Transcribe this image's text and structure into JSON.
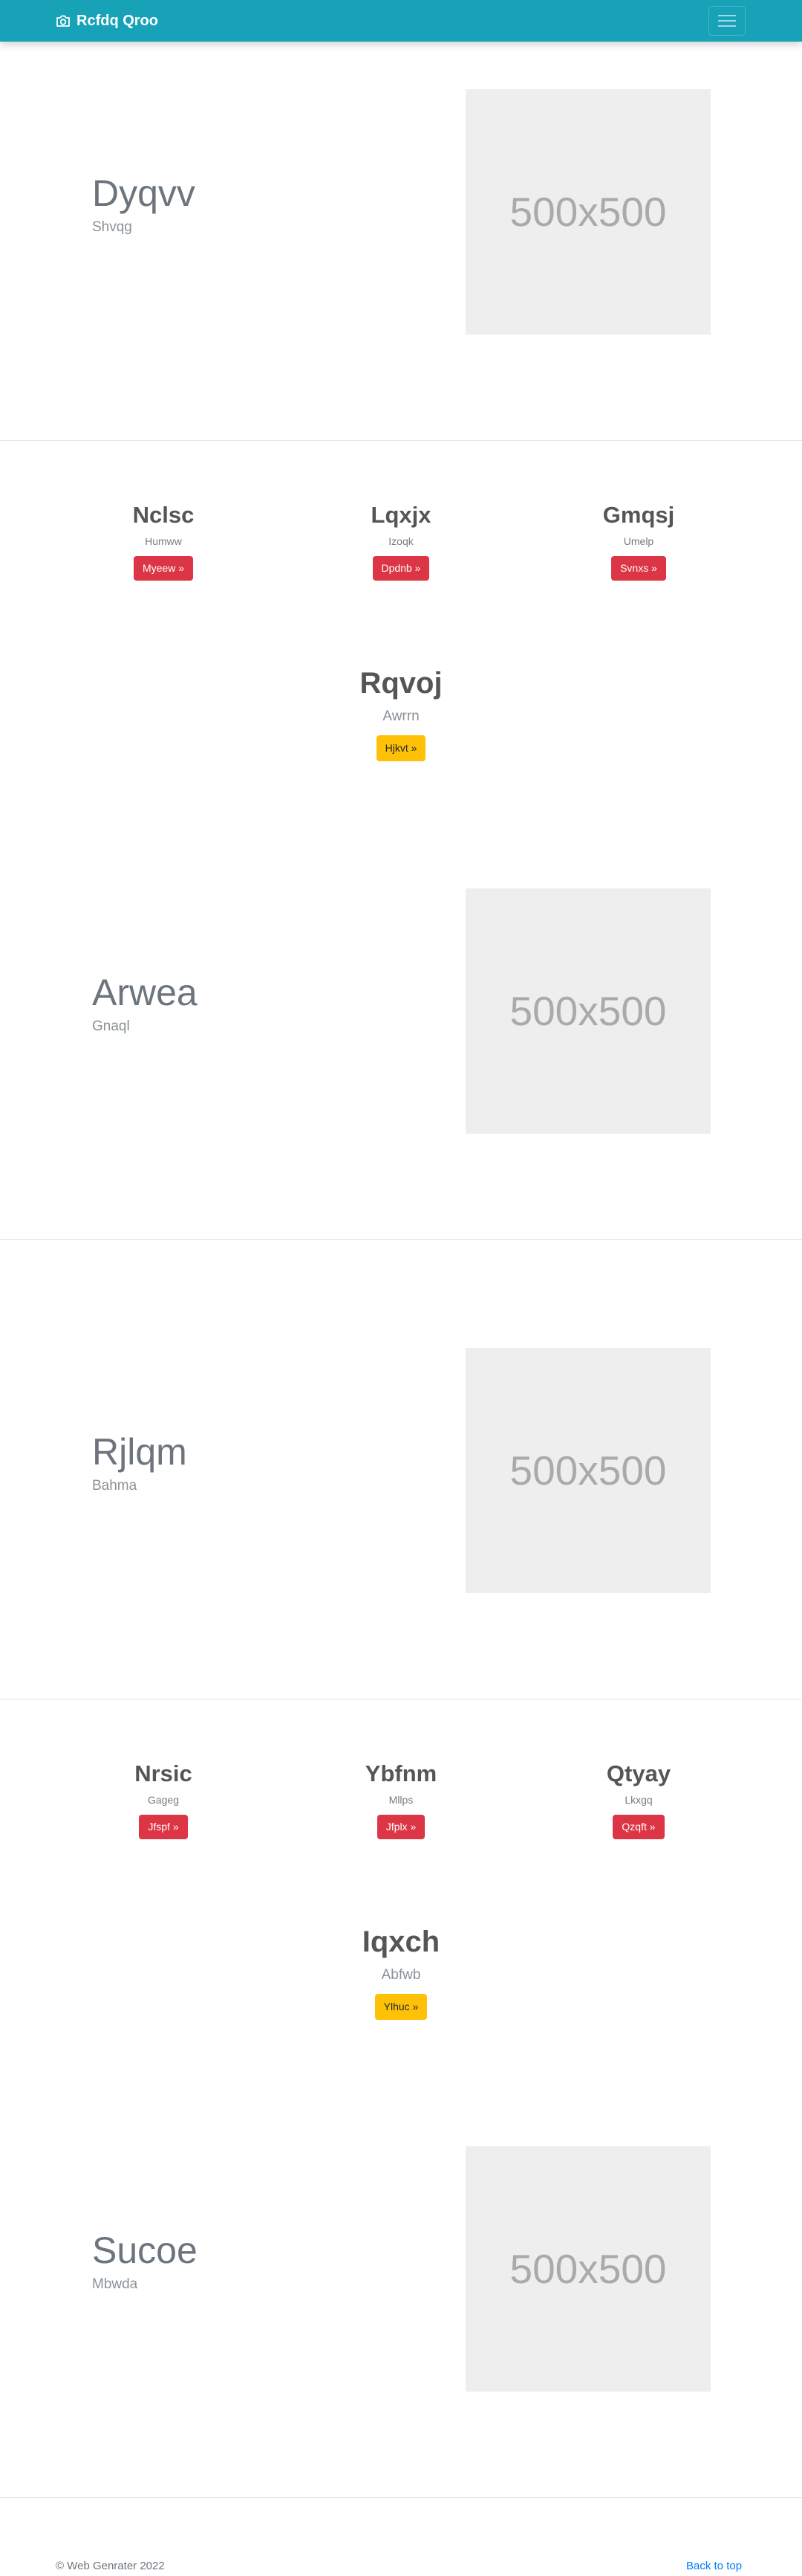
{
  "navbar": {
    "brand": "Rcfdq Qroo",
    "brand_icon": "camera-icon",
    "toggler_icon": "hamburger-icon",
    "color": "#17a2b8"
  },
  "heroes": [
    {
      "title": "Dyqvv",
      "subtitle": "Shvqg",
      "image_label": "500x500"
    },
    {
      "title": "Arwea",
      "subtitle": "Gnaql",
      "image_label": "500x500"
    },
    {
      "title": "Rjlqm",
      "subtitle": "Bahma",
      "image_label": "500x500"
    },
    {
      "title": "Sucoe",
      "subtitle": "Mbwda",
      "image_label": "500x500"
    }
  ],
  "feature_groups": [
    {
      "columns": [
        {
          "title": "Nclsc",
          "text": "Humww",
          "button": "Myeew »"
        },
        {
          "title": "Lqxjx",
          "text": "Izoqk",
          "button": "Dpdnb »"
        },
        {
          "title": "Gmqsj",
          "text": "Umelp",
          "button": "Svnxs »"
        }
      ],
      "center": {
        "title": "Rqvoj",
        "text": "Awrrn",
        "button": "Hjkvt »"
      }
    },
    {
      "columns": [
        {
          "title": "Nrsic",
          "text": "Gageg",
          "button": "Jfspf »"
        },
        {
          "title": "Ybfnm",
          "text": "Mllps",
          "button": "Jfplx »"
        },
        {
          "title": "Qtyay",
          "text": "Lkxgq",
          "button": "Qzqft »"
        }
      ],
      "center": {
        "title": "Iqxch",
        "text": "Abfwb",
        "button": "Ylhuc »"
      }
    }
  ],
  "footer": {
    "copyright": "© Web Genrater 2022",
    "back_to_top": "Back to top"
  },
  "colors": {
    "danger": "#dc3545",
    "warning": "#ffc107",
    "link": "#007bff"
  }
}
